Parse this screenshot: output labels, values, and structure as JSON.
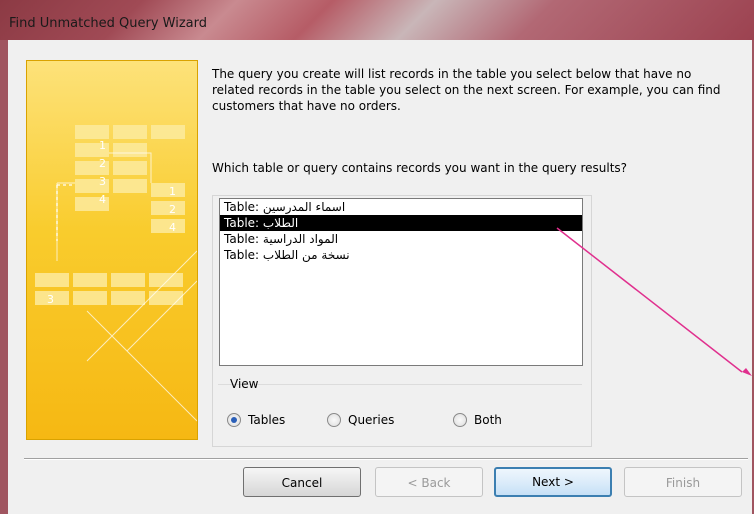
{
  "window": {
    "title": "Find Unmatched Query Wizard"
  },
  "illustration": {
    "numbers_left": [
      "1",
      "2",
      "3",
      "4"
    ],
    "numbers_right": [
      "1",
      "2",
      "4"
    ],
    "bottom_number": "3"
  },
  "description": "The query you create will list records in the table you select below that have no related records in the table you select on the next screen. For example, you can find customers that have no orders.",
  "question": "Which table or query contains records you want in the query results?",
  "table_list": {
    "items": [
      {
        "prefix": "Table:",
        "name": "اسماء المدرسين",
        "selected": false
      },
      {
        "prefix": "Table:",
        "name": "الطلاب",
        "selected": true
      },
      {
        "prefix": "Table:",
        "name": "المواد الدراسية",
        "selected": false
      },
      {
        "prefix": "Table:",
        "name": "نسخة من  الطلاب",
        "selected": false
      }
    ]
  },
  "view": {
    "legend": "View",
    "options": [
      {
        "label": "Tables",
        "checked": true
      },
      {
        "label": "Queries",
        "checked": false
      },
      {
        "label": "Both",
        "checked": false
      }
    ]
  },
  "buttons": {
    "cancel": "Cancel",
    "back": "< Back",
    "next": "Next >",
    "finish": "Finish"
  },
  "colors": {
    "annotation_arrow": "#e0308e",
    "selection": "#000000",
    "illustration": "#f9cc2d"
  }
}
